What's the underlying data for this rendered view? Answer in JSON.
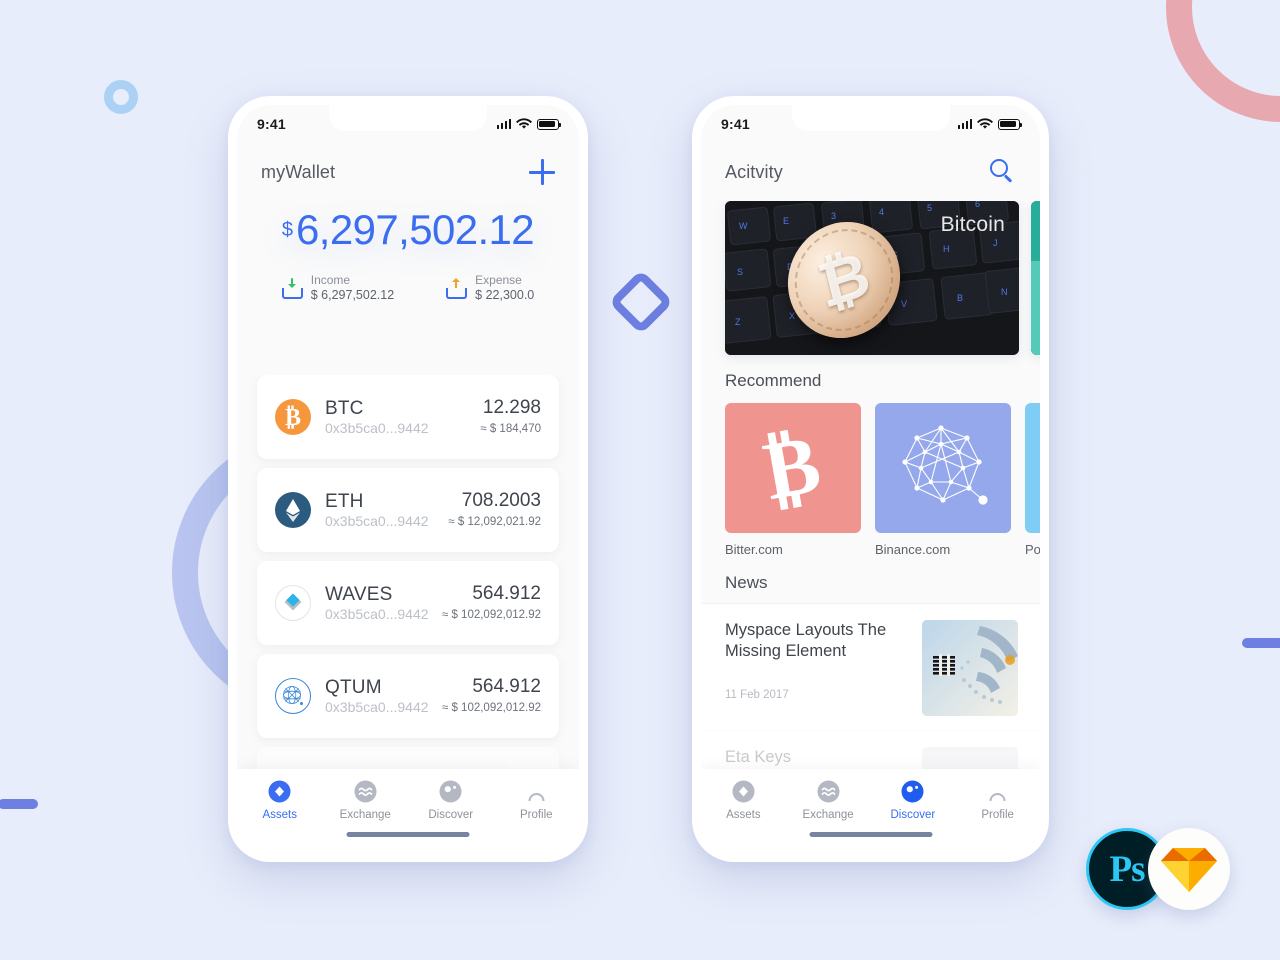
{
  "theme": {
    "background": "#e8edfb",
    "accent": "#3a6df0",
    "muted_text": "#8d929b",
    "card_bg": "#ffffff"
  },
  "decorations": [
    {
      "name": "ring-pink",
      "color": "#e8a8b0"
    },
    {
      "name": "ring-periwinkle",
      "color": "#b9c5f0"
    },
    {
      "name": "ring-lightblue",
      "color": "#abd2f5"
    },
    {
      "name": "diamond",
      "color": "#6d7fe0"
    },
    {
      "name": "bar-left",
      "color": "#6d7fe0"
    },
    {
      "name": "bar-right",
      "color": "#6d7fe0"
    }
  ],
  "status_bar": {
    "time": "9:41",
    "icons": [
      "signal-icon",
      "wifi-icon",
      "battery-icon"
    ]
  },
  "assets_screen": {
    "header": {
      "title": "myWallet",
      "action_icon": "plus-icon"
    },
    "balance": {
      "currency_symbol": "$",
      "amount": "6,297,502.12"
    },
    "summary": [
      {
        "icon": "tray-download-icon",
        "label": "Income",
        "value": "$ 6,297,502.12"
      },
      {
        "icon": "tray-upload-icon",
        "label": "Expense",
        "value": "$ 22,300.0"
      }
    ],
    "assets": [
      {
        "icon": "bitcoin-icon",
        "symbol": "BTC",
        "address": "0x3b5ca0...9442",
        "amount": "12.298",
        "fiat": "≈ $ 184,470"
      },
      {
        "icon": "ethereum-icon",
        "symbol": "ETH",
        "address": "0x3b5ca0...9442",
        "amount": "708.2003",
        "fiat": "≈ $ 12,092,021.92"
      },
      {
        "icon": "waves-icon",
        "symbol": "WAVES",
        "address": "0x3b5ca0...9442",
        "amount": "564.912",
        "fiat": "≈ $ 102,092,012.92"
      },
      {
        "icon": "qtum-icon",
        "symbol": "QTUM",
        "address": "0x3b5ca0...9442",
        "amount": "564.912",
        "fiat": "≈ $ 102,092,012.92"
      }
    ],
    "tabs": [
      {
        "icon": "assets-icon",
        "label": "Assets",
        "active": true
      },
      {
        "icon": "exchange-icon",
        "label": "Exchange",
        "active": false
      },
      {
        "icon": "discover-icon",
        "label": "Discover",
        "active": false
      },
      {
        "icon": "profile-icon",
        "label": "Profile",
        "active": false
      }
    ]
  },
  "discover_screen": {
    "header": {
      "title": "Acitvity",
      "action_icon": "search-icon"
    },
    "banners": [
      {
        "label": "Bitcoin",
        "image": "bitcoin-coin-on-keyboard"
      },
      {
        "label": "",
        "image": "teal-abstract"
      }
    ],
    "recommend": {
      "section_title": "Recommend",
      "items": [
        {
          "name": "Bitter.com",
          "icon": "bitcoin-icon",
          "color": "#f09490"
        },
        {
          "name": "Binance.com",
          "icon": "network-icon",
          "color": "#96a8ec"
        },
        {
          "name": "Polonie",
          "icon": "polygon-icon",
          "color": "#7ecdf5"
        }
      ]
    },
    "news": {
      "section_title": "News",
      "items": [
        {
          "title": "Myspace Layouts The Missing Element",
          "date": "11 Feb 2017",
          "thumb": "ibm-server-photo"
        },
        {
          "title": "Eta Keys",
          "date": "",
          "thumb": "portrait-photo"
        }
      ]
    },
    "tabs": [
      {
        "icon": "assets-icon",
        "label": "Assets",
        "active": false
      },
      {
        "icon": "exchange-icon",
        "label": "Exchange",
        "active": false
      },
      {
        "icon": "discover-icon",
        "label": "Discover",
        "active": true
      },
      {
        "icon": "profile-icon",
        "label": "Profile",
        "active": false
      }
    ]
  },
  "tool_badges": [
    {
      "name": "photoshop-badge",
      "label": "Ps"
    },
    {
      "name": "sketch-badge",
      "label": ""
    }
  ]
}
